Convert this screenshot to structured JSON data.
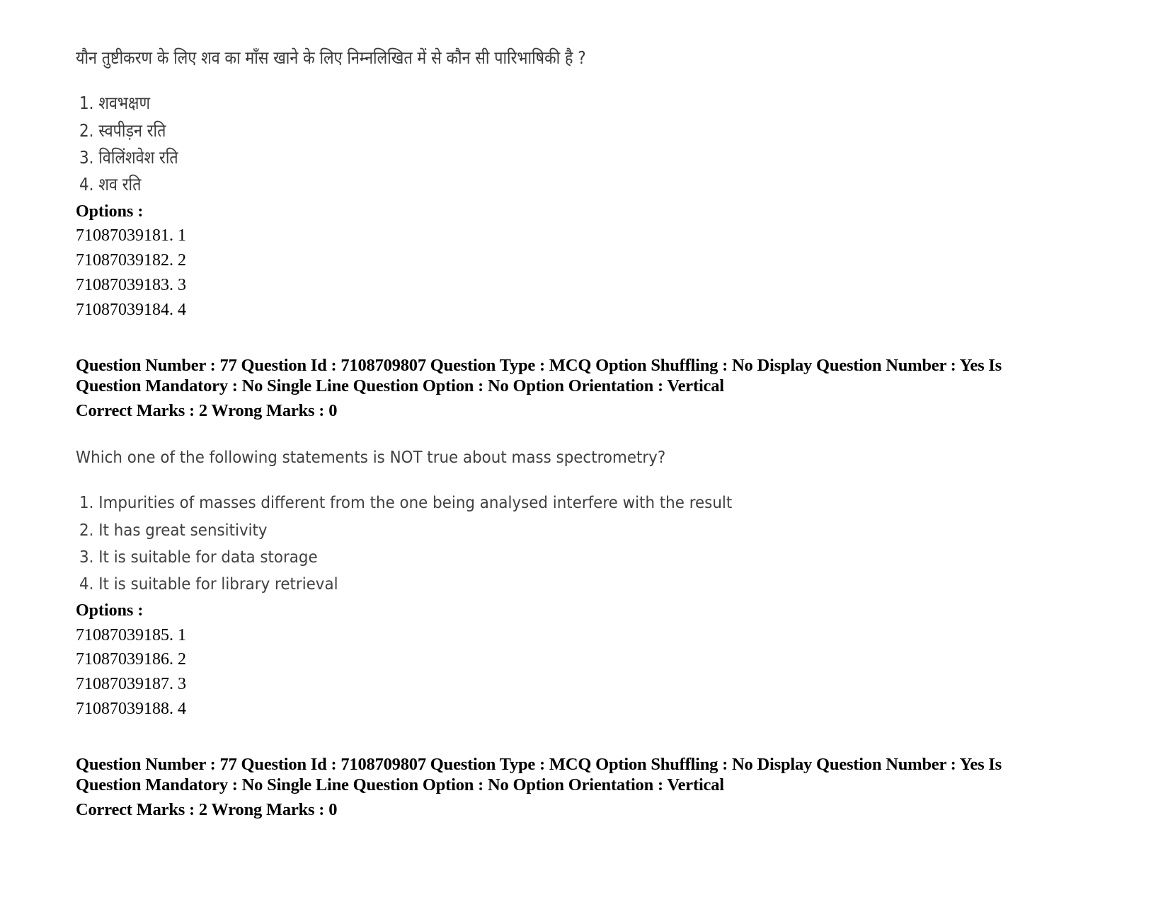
{
  "questions": [
    {
      "question_text": "यौन तुष्टीकरण के लिए शव का माँस खाने के लिए निम्नलिखित में से कौन सी पारिभाषिकी है ?",
      "choices": [
        "1. शवभक्षण",
        "2. स्वपीड़न रति",
        "3. विलिंशवेश रति",
        "4. शव रति"
      ],
      "options_label": "Options :",
      "options": [
        "71087039181. 1",
        "71087039182. 2",
        "71087039183. 3",
        "71087039184. 4"
      ]
    },
    {
      "meta_line1": "Question Number : 77 Question Id : 7108709807 Question Type : MCQ Option Shuffling : No Display Question Number : Yes Is",
      "meta_line2": "Question Mandatory : No Single Line Question Option : No Option Orientation : Vertical",
      "marks": "Correct Marks : 2 Wrong Marks : 0",
      "question_text": "Which one of the following statements is NOT true about mass spectrometry?",
      "choices": [
        "1. Impurities of masses different from the one being analysed interfere with the result",
        "2. It has great sensitivity",
        "3. It is suitable for data storage",
        "4. It is suitable for library retrieval"
      ],
      "options_label": "Options :",
      "options": [
        "71087039185. 1",
        "71087039186. 2",
        "71087039187. 3",
        "71087039188. 4"
      ]
    },
    {
      "meta_line1": "Question Number : 77 Question Id : 7108709807 Question Type : MCQ Option Shuffling : No Display Question Number : Yes Is",
      "meta_line2": "Question Mandatory : No Single Line Question Option : No Option Orientation : Vertical",
      "marks": "Correct Marks : 2 Wrong Marks : 0"
    }
  ]
}
